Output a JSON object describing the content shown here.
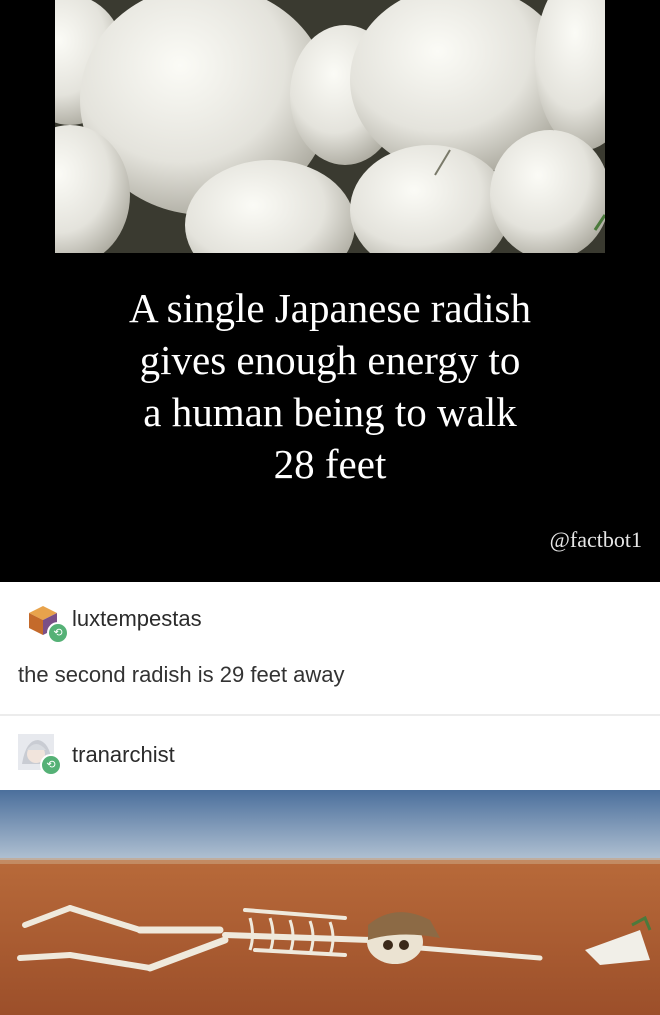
{
  "meme": {
    "fact_lines": [
      "A single Japanese radish",
      "gives enough energy to",
      "a human being to walk",
      "28 feet"
    ],
    "handle": "@factbot1"
  },
  "reblogs": [
    {
      "username": "luxtempestas",
      "text": "the second radish is 29 feet away"
    },
    {
      "username": "tranarchist"
    }
  ],
  "colors": {
    "reblog_badge": "#55b176",
    "background_top": "#000000"
  }
}
